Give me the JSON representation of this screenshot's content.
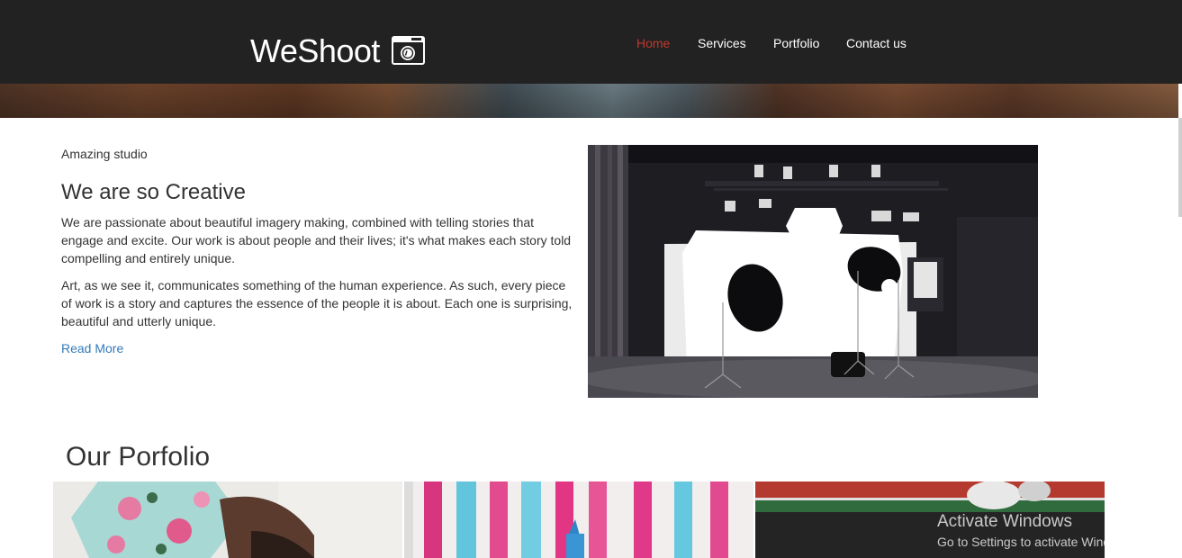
{
  "header": {
    "logo_text": "WeShoot",
    "nav": [
      {
        "label": "Home",
        "active": true
      },
      {
        "label": "Services",
        "active": false
      },
      {
        "label": "Portfolio",
        "active": false
      },
      {
        "label": "Contact us",
        "active": false
      }
    ]
  },
  "about": {
    "tagline": "Amazing studio",
    "title": "We are so Creative",
    "paragraph_1": "We are passionate about beautiful imagery making, combined with telling stories that engage and excite. Our work is about people and their lives; it's what makes each story told compelling and entirely unique.",
    "paragraph_2": "Art, as we see it, communicates something of the human experience. As such, every piece of work is a story and captures the essence of the people it is about. Each one is surprising, beautiful and utterly unique.",
    "read_more": "Read More"
  },
  "portfolio": {
    "title": "Our Porfolio"
  },
  "watermark": {
    "title": "Activate Windows",
    "subtitle": "Go to Settings to activate Windows."
  },
  "colors": {
    "header_bg": "#222222",
    "nav_active": "#c0392b",
    "link": "#337ab7"
  },
  "icons": [
    "camera-icon"
  ]
}
